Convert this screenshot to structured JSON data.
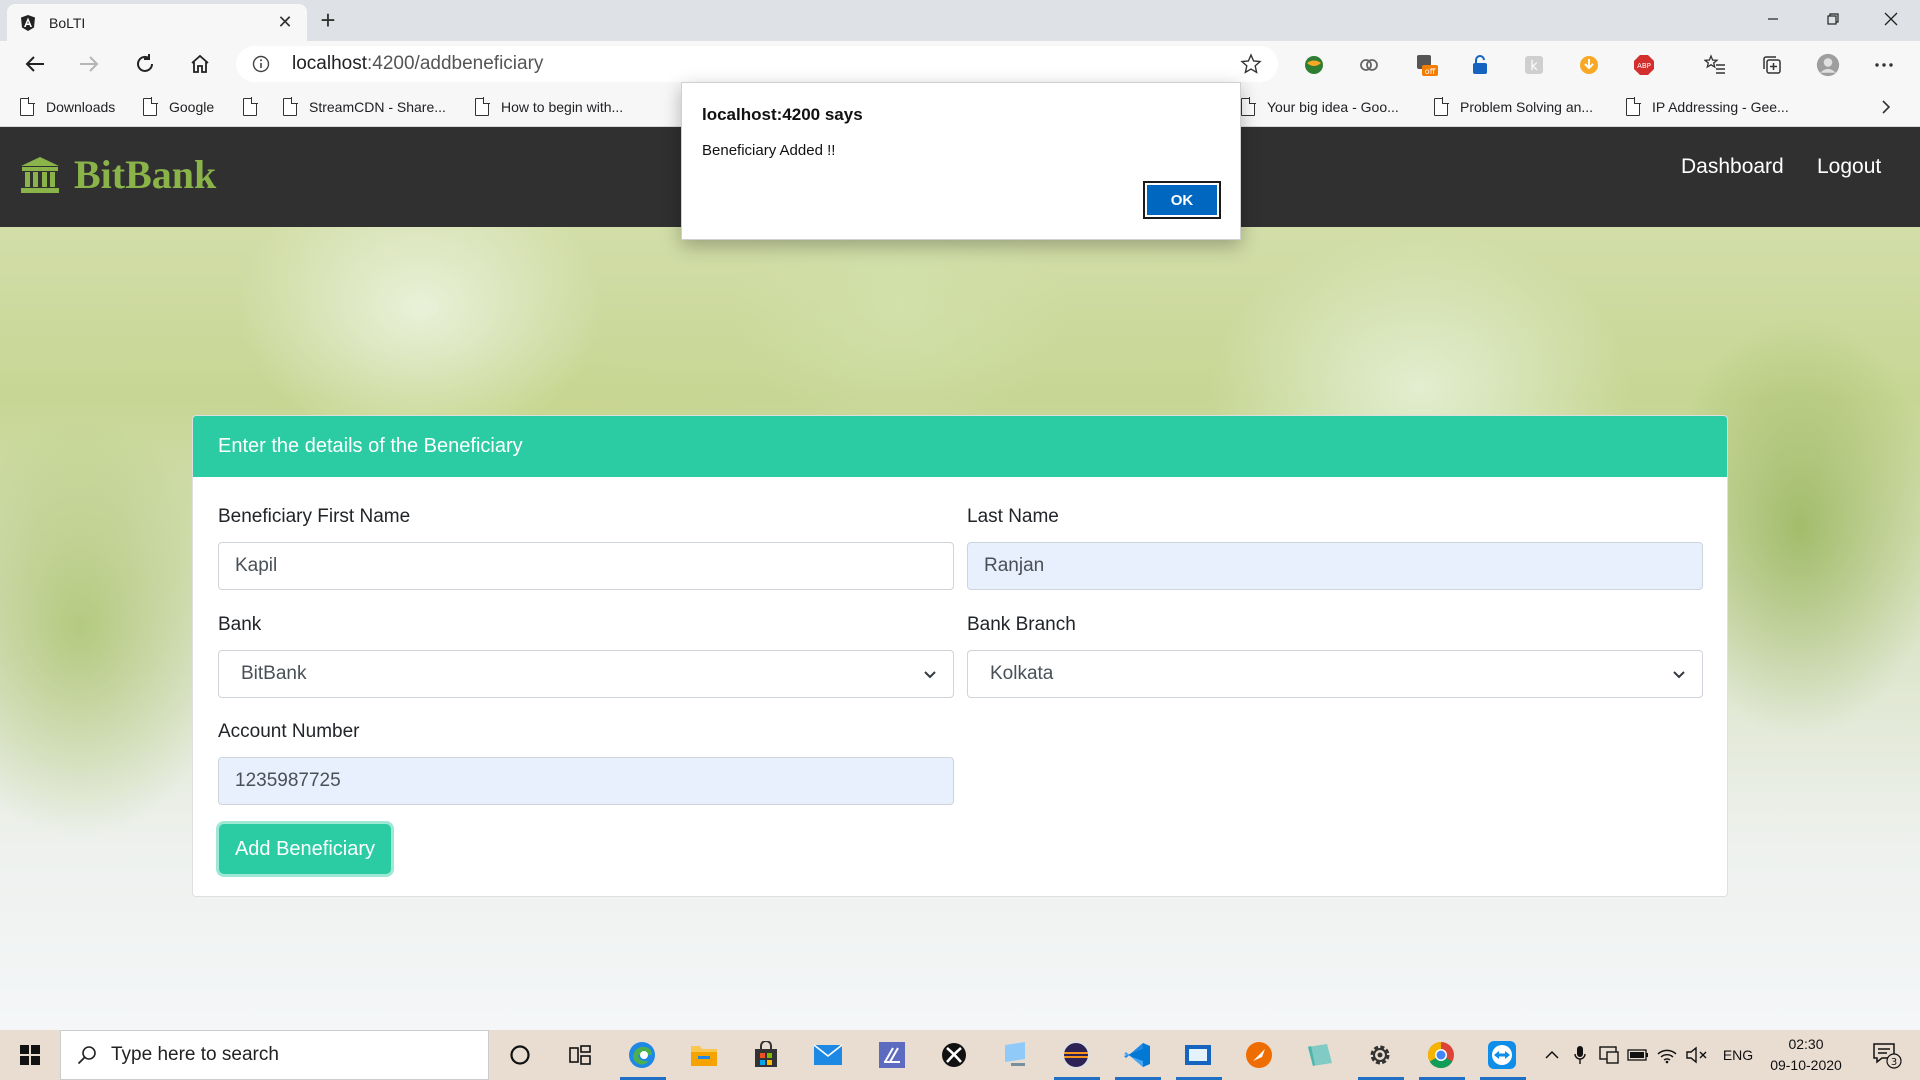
{
  "browser": {
    "tab_title": "BoLTI",
    "url_host": "localhost",
    "url_rest": ":4200/addbeneficiary",
    "bookmarks": [
      "Downloads",
      "Google",
      "",
      "StreamCDN - Share...",
      "How to begin with...",
      "Your big idea - Goo...",
      "Problem Solving an...",
      "IP Addressing - Gee..."
    ]
  },
  "navbar": {
    "brand": "BitBank",
    "links": [
      "Dashboard",
      "Logout"
    ]
  },
  "form": {
    "header": "Enter the details of the Beneficiary",
    "first_name": {
      "label": "Beneficiary First Name",
      "value": "Kapil"
    },
    "last_name": {
      "label": "Last Name",
      "value": "Ranjan"
    },
    "bank": {
      "label": "Bank",
      "value": "BitBank"
    },
    "branch": {
      "label": "Bank Branch",
      "value": "Kolkata"
    },
    "account": {
      "label": "Account Number",
      "value": "1235987725"
    },
    "submit_label": "Add Beneficiary"
  },
  "dialog": {
    "title": "localhost:4200 says",
    "message": "Beneficiary Added !!",
    "ok_label": "OK"
  },
  "taskbar": {
    "search_placeholder": "Type here to search",
    "language": "ENG",
    "time": "02:30",
    "date": "09-10-2020",
    "notification_count": "3"
  },
  "colors": {
    "accent": "#2bcca4",
    "brand": "#8ab34a",
    "navbar": "#303030",
    "dialog_button": "#0067c0"
  }
}
